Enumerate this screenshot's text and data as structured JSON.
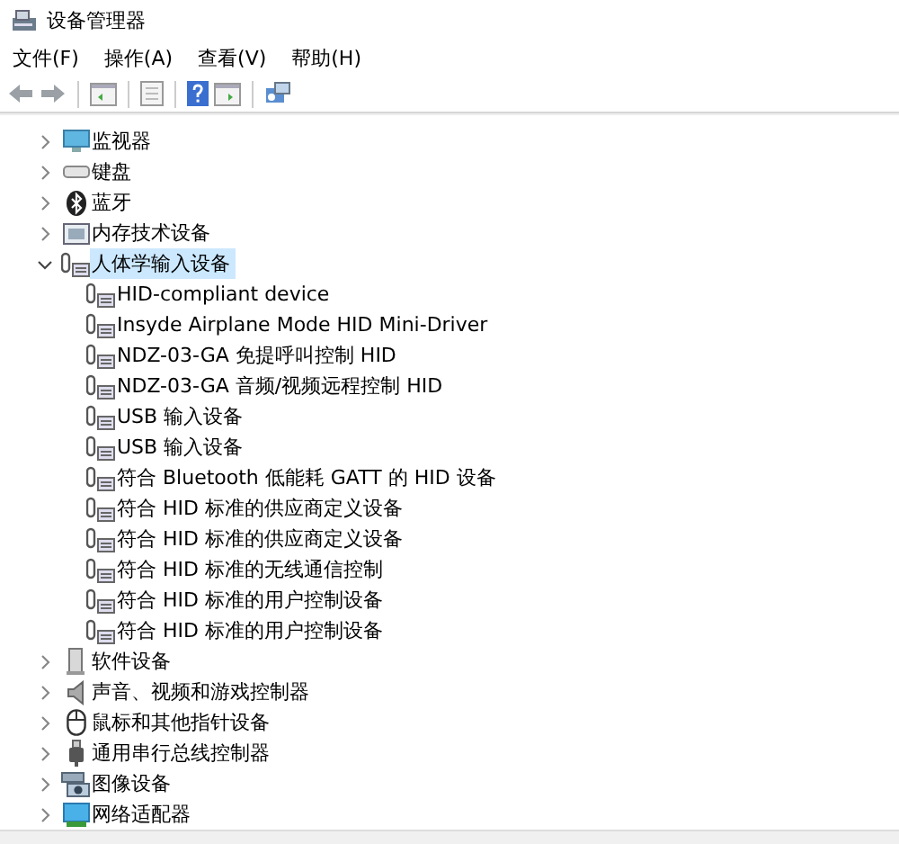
{
  "window": {
    "title": "设备管理器"
  },
  "menu": [
    "文件(F)",
    "操作(A)",
    "查看(V)",
    "帮助(H)"
  ],
  "tree": [
    {
      "label": "监视器",
      "kind": "monitor",
      "expanded": false,
      "selected": false
    },
    {
      "label": "键盘",
      "kind": "keyboard",
      "expanded": false,
      "selected": false
    },
    {
      "label": "蓝牙",
      "kind": "bluetooth",
      "expanded": false,
      "selected": false
    },
    {
      "label": "内存技术设备",
      "kind": "memory",
      "expanded": false,
      "selected": false
    },
    {
      "label": "人体学输入设备",
      "kind": "hid",
      "expanded": true,
      "selected": true,
      "children": [
        {
          "label": "HID-compliant device",
          "kind": "hid",
          "selected": false
        },
        {
          "label": "Insyde Airplane Mode HID Mini-Driver",
          "kind": "hid",
          "selected": false
        },
        {
          "label": "NDZ-03-GA 免提呼叫控制 HID",
          "kind": "hid",
          "selected": false
        },
        {
          "label": "NDZ-03-GA 音频/视频远程控制 HID",
          "kind": "hid",
          "selected": false
        },
        {
          "label": "USB 输入设备",
          "kind": "hid",
          "selected": false
        },
        {
          "label": "USB 输入设备",
          "kind": "hid",
          "selected": false
        },
        {
          "label": "符合 Bluetooth 低能耗 GATT 的 HID 设备",
          "kind": "hid",
          "selected": false
        },
        {
          "label": "符合 HID 标准的供应商定义设备",
          "kind": "hid",
          "selected": false
        },
        {
          "label": "符合 HID 标准的供应商定义设备",
          "kind": "hid",
          "selected": false
        },
        {
          "label": "符合 HID 标准的无线通信控制",
          "kind": "hid",
          "selected": false
        },
        {
          "label": "符合 HID 标准的用户控制设备",
          "kind": "hid",
          "selected": false
        },
        {
          "label": "符合 HID 标准的用户控制设备",
          "kind": "hid",
          "selected": false
        }
      ]
    },
    {
      "label": "软件设备",
      "kind": "software",
      "expanded": false,
      "selected": false
    },
    {
      "label": "声音、视频和游戏控制器",
      "kind": "audio",
      "expanded": false,
      "selected": false
    },
    {
      "label": "鼠标和其他指针设备",
      "kind": "mouse",
      "expanded": false,
      "selected": false
    },
    {
      "label": "通用串行总线控制器",
      "kind": "usb",
      "expanded": false,
      "selected": false
    },
    {
      "label": "图像设备",
      "kind": "camera",
      "expanded": false,
      "selected": false
    },
    {
      "label": "网络适配器",
      "kind": "network",
      "expanded": false,
      "selected": false
    }
  ]
}
